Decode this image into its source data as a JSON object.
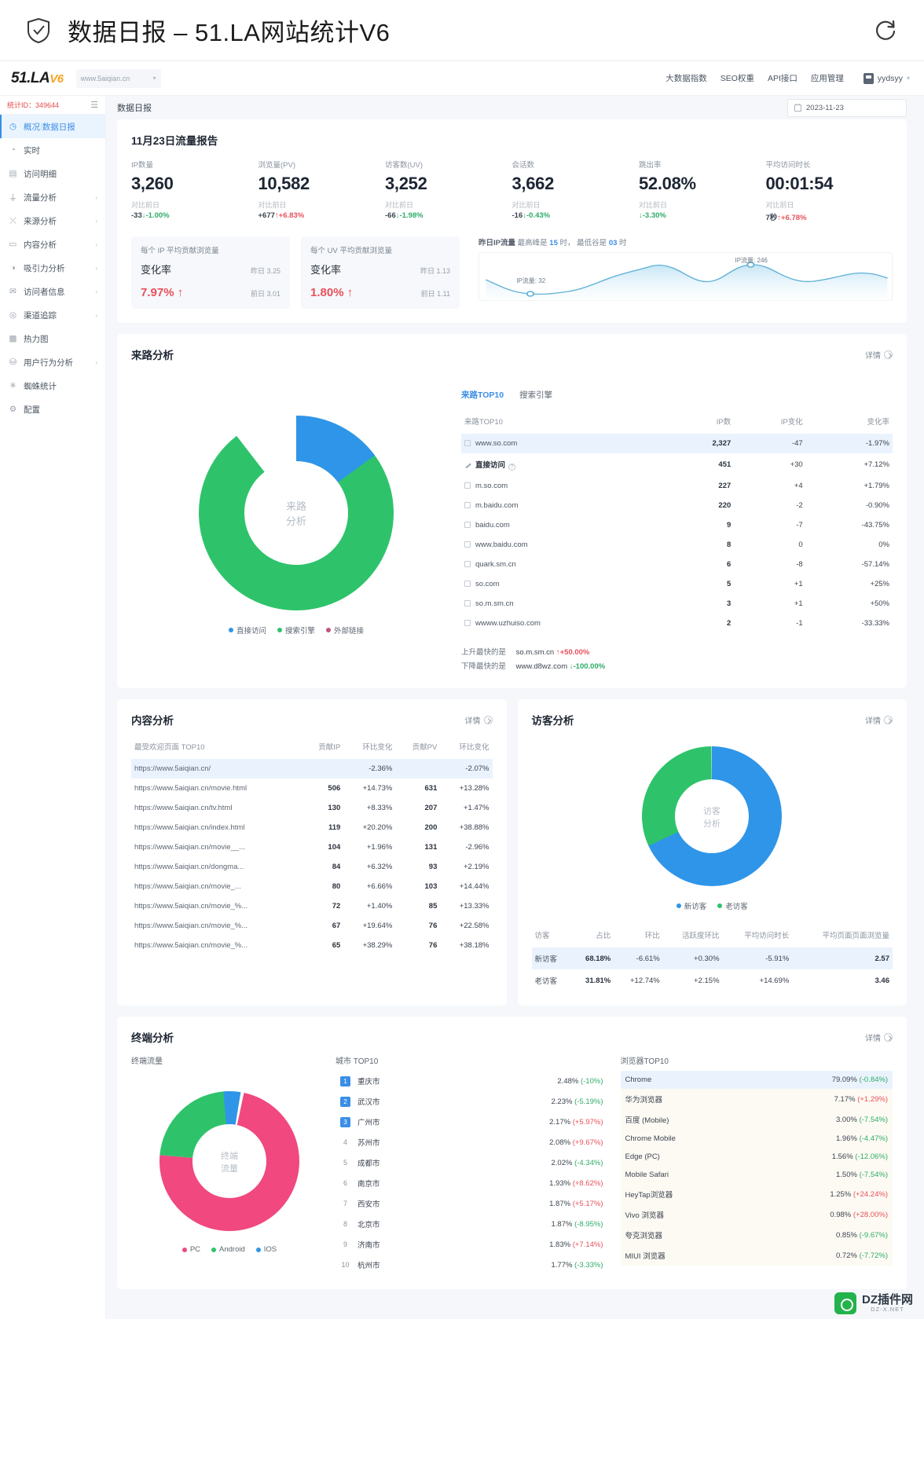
{
  "window": {
    "title": "数据日报 – 51.LA网站统计V6",
    "shield_icon": "shield-check-icon",
    "refresh_icon": "refresh-icon"
  },
  "appnav": {
    "logo": "51.LA",
    "logo_version": "V6",
    "site": "www.5aiqian.cn",
    "links": [
      "大数据指数",
      "SEO权重",
      "API接口",
      "应用管理"
    ],
    "user": "yydsyy"
  },
  "sidebar": {
    "stat_id_label": "统计ID：349644",
    "items": [
      {
        "label": "概况",
        "sub": "数据日报",
        "icon": "gauge-icon",
        "active": true,
        "chevron": false
      },
      {
        "label": "实时",
        "icon": "clock-icon",
        "active": false,
        "chevron": false
      },
      {
        "label": "访问明细",
        "icon": "list-icon",
        "active": false,
        "chevron": false
      },
      {
        "label": "流量分析",
        "icon": "chart-icon",
        "active": false,
        "chevron": true
      },
      {
        "label": "来源分析",
        "icon": "share-icon",
        "active": false,
        "chevron": true
      },
      {
        "label": "内容分析",
        "icon": "doc-icon",
        "active": false,
        "chevron": true
      },
      {
        "label": "吸引力分析",
        "icon": "magnet-icon",
        "active": false,
        "chevron": true
      },
      {
        "label": "访问者信息",
        "icon": "mail-icon",
        "active": false,
        "chevron": true
      },
      {
        "label": "渠道追踪",
        "icon": "target-icon",
        "active": false,
        "chevron": true
      },
      {
        "label": "热力图",
        "icon": "heatmap-icon",
        "active": false,
        "chevron": false
      },
      {
        "label": "用户行为分析",
        "icon": "behavior-icon",
        "active": false,
        "chevron": true
      },
      {
        "label": "蜘蛛统计",
        "icon": "spider-icon",
        "active": false,
        "chevron": false
      },
      {
        "label": "配置",
        "icon": "gear-icon",
        "active": false,
        "chevron": false
      }
    ]
  },
  "breadcrumb": "数据日报",
  "date_picker": {
    "value": "2023-11-23",
    "icon": "calendar-icon"
  },
  "report": {
    "title": "11月23日流量报告",
    "kpis": [
      {
        "label": "IP数量",
        "value": "3,260",
        "sub": "对比前日",
        "delta": "-33",
        "dir": "down",
        "pct": "-1.00%"
      },
      {
        "label": "浏览量(PV)",
        "value": "10,582",
        "sub": "对比前日",
        "delta": "+677",
        "dir": "up",
        "pct": "+6.83%"
      },
      {
        "label": "访客数(UV)",
        "value": "3,252",
        "sub": "对比前日",
        "delta": "-66",
        "dir": "down",
        "pct": "-1.98%"
      },
      {
        "label": "会话数",
        "value": "3,662",
        "sub": "对比前日",
        "delta": "-16",
        "dir": "down",
        "pct": "-0.43%"
      },
      {
        "label": "跳出率",
        "value": "52.08%",
        "sub": "对比前日",
        "delta": "",
        "dir": "down",
        "pct": "-3.30%"
      },
      {
        "label": "平均访问时长",
        "value": "00:01:54",
        "sub": "对比前日",
        "delta": "7秒",
        "dir": "up",
        "pct": "+6.78%"
      }
    ],
    "rate_cards": [
      {
        "title": "每个 IP 平均贡献浏览量",
        "name": "变化率",
        "value": "7.97%",
        "dir": "up",
        "yesterday_label": "昨日",
        "yesterday": "3.25",
        "before_label": "前日",
        "before": "3.01"
      },
      {
        "title": "每个 UV 平均贡献浏览量",
        "name": "变化率",
        "value": "1.80%",
        "dir": "up",
        "yesterday_label": "昨日",
        "yesterday": "1.13",
        "before_label": "前日",
        "before": "1.11"
      }
    ],
    "spark": {
      "caption_bold": "昨日IP流量",
      "caption_peak_label": "最高峰是",
      "caption_peak": "15",
      "caption_peak_unit": "时，",
      "caption_low_label": "最低谷是",
      "caption_low": "03",
      "caption_low_unit": "时",
      "peak_label": "IP流量: 246",
      "low_label": "IP流量: 32"
    }
  },
  "referrer": {
    "title": "来路分析",
    "detail": "详情",
    "donut_center_1": "来路",
    "donut_center_2": "分析",
    "legend": [
      {
        "label": "直接访问",
        "color": "#2f95e8"
      },
      {
        "label": "搜索引擎",
        "color": "#2ec36b"
      },
      {
        "label": "外部链接",
        "color": "#c2557e"
      }
    ],
    "tabs": [
      {
        "label": "来路TOP10",
        "active": true
      },
      {
        "label": "搜索引擎",
        "active": false
      }
    ],
    "columns": [
      "来路TOP10",
      "IP数",
      "IP变化",
      "变化率"
    ],
    "rows": [
      {
        "name": "www.so.com",
        "icon": "site-icon",
        "ip": "2,327",
        "chg": "-47",
        "rate": "-1.97%",
        "dir": "down",
        "hi": true
      },
      {
        "name": "直接访问",
        "icon": "link-icon",
        "ip": "451",
        "chg": "+30",
        "rate": "+7.12%",
        "dir": "up",
        "help": true,
        "bold": true
      },
      {
        "name": "m.so.com",
        "icon": "site-icon",
        "ip": "227",
        "chg": "+4",
        "rate": "+1.79%",
        "dir": "up"
      },
      {
        "name": "m.baidu.com",
        "icon": "site-icon",
        "ip": "220",
        "chg": "-2",
        "rate": "-0.90%",
        "dir": "down"
      },
      {
        "name": "baidu.com",
        "icon": "site-icon",
        "ip": "9",
        "chg": "-7",
        "rate": "-43.75%",
        "dir": "down"
      },
      {
        "name": "www.baidu.com",
        "icon": "site-icon",
        "ip": "8",
        "chg": "0",
        "rate": "0%",
        "dir": "up"
      },
      {
        "name": "quark.sm.cn",
        "icon": "site-icon",
        "ip": "6",
        "chg": "-8",
        "rate": "-57.14%",
        "dir": "down"
      },
      {
        "name": "so.com",
        "icon": "site-icon",
        "ip": "5",
        "chg": "+1",
        "rate": "+25%",
        "dir": "up"
      },
      {
        "name": "so.m.sm.cn",
        "icon": "site-icon",
        "ip": "3",
        "chg": "+1",
        "rate": "+50%",
        "dir": "up"
      },
      {
        "name": "wwww.uzhuiso.com",
        "icon": "site-icon",
        "ip": "2",
        "chg": "-1",
        "rate": "-33.33%",
        "dir": "down"
      }
    ],
    "note_up_label": "上升最快的是",
    "note_up_name": "so.m.sm.cn",
    "note_up_pct": "+50.00%",
    "note_down_label": "下降最快的是",
    "note_down_name": "www.d8wz.com",
    "note_down_pct": "-100.00%",
    "chart_data": {
      "type": "pie",
      "title": "来路分析",
      "categories": [
        "直接访问",
        "搜索引擎",
        "外部链接"
      ],
      "values": [
        15,
        84,
        1
      ],
      "colors": [
        "#2f95e8",
        "#2ec36b",
        "#c2557e"
      ]
    }
  },
  "content": {
    "title": "内容分析",
    "detail": "详情",
    "columns": [
      "最受欢迎页面 TOP10",
      "贡献IP",
      "环比变化",
      "贡献PV",
      "环比变化"
    ],
    "rows": [
      {
        "page": "https://www.5aiqian.cn/",
        "ip": "",
        "ipc": "-2.36%",
        "ipd": "down",
        "pv": "",
        "pvc": "-2.07%",
        "pvd": "down",
        "hi": true
      },
      {
        "page": "https://www.5aiqian.cn/movie.html",
        "ip": "506",
        "ipc": "+14.73%",
        "ipd": "up",
        "pv": "631",
        "pvc": "+13.28%",
        "pvd": "up"
      },
      {
        "page": "https://www.5aiqian.cn/tv.html",
        "ip": "130",
        "ipc": "+8.33%",
        "ipd": "up",
        "pv": "207",
        "pvc": "+1.47%",
        "pvd": "up"
      },
      {
        "page": "https://www.5aiqian.cn/index.html",
        "ip": "119",
        "ipc": "+20.20%",
        "ipd": "up",
        "pv": "200",
        "pvc": "+38.88%",
        "pvd": "up"
      },
      {
        "page": "https://www.5aiqian.cn/movie__...",
        "ip": "104",
        "ipc": "+1.96%",
        "ipd": "up",
        "pv": "131",
        "pvc": "-2.96%",
        "pvd": "down"
      },
      {
        "page": "https://www.5aiqian.cn/dongma...",
        "ip": "84",
        "ipc": "+6.32%",
        "ipd": "up",
        "pv": "93",
        "pvc": "+2.19%",
        "pvd": "up"
      },
      {
        "page": "https://www.5aiqian.cn/movie_...",
        "ip": "80",
        "ipc": "+6.66%",
        "ipd": "up",
        "pv": "103",
        "pvc": "+14.44%",
        "pvd": "up"
      },
      {
        "page": "https://www.5aiqian.cn/movie_%...",
        "ip": "72",
        "ipc": "+1.40%",
        "ipd": "up",
        "pv": "85",
        "pvc": "+13.33%",
        "pvd": "up"
      },
      {
        "page": "https://www.5aiqian.cn/movie_%...",
        "ip": "67",
        "ipc": "+19.64%",
        "ipd": "up",
        "pv": "76",
        "pvc": "+22.58%",
        "pvd": "up"
      },
      {
        "page": "https://www.5aiqian.cn/movie_%...",
        "ip": "65",
        "ipc": "+38.29%",
        "ipd": "up",
        "pv": "76",
        "pvc": "+38.18%",
        "pvd": "up"
      }
    ]
  },
  "visitor": {
    "title": "访客分析",
    "detail": "详情",
    "donut_center_1": "访客",
    "donut_center_2": "分析",
    "legend": [
      {
        "label": "新访客",
        "color": "#2f95e8"
      },
      {
        "label": "老访客",
        "color": "#2ec36b"
      }
    ],
    "columns": [
      "访客",
      "占比",
      "环比",
      "活跃度环比",
      "平均访问时长",
      "平均页面页面浏览量"
    ],
    "rows": [
      {
        "name": "新访客",
        "pct": "68.18%",
        "hb": "-6.61%",
        "hbd": "down",
        "act": "+0.30%",
        "actd": "up",
        "dur": "-5.91%",
        "durd": "down",
        "pv": "2.57",
        "hi": true
      },
      {
        "name": "老访客",
        "pct": "31.81%",
        "hb": "+12.74%",
        "hbd": "up",
        "act": "+2.15%",
        "actd": "up",
        "dur": "+14.69%",
        "durd": "up",
        "pv": "3.46"
      }
    ],
    "chart_data": {
      "type": "pie",
      "title": "访客分析",
      "categories": [
        "新访客",
        "老访客"
      ],
      "values": [
        68.18,
        31.81
      ],
      "colors": [
        "#2f95e8",
        "#2ec36b"
      ]
    }
  },
  "terminal": {
    "title": "终端分析",
    "detail": "详情",
    "donut_title": "终端流量",
    "donut_center_1": "终端",
    "donut_center_2": "流量",
    "legend": [
      {
        "label": "PC",
        "color": "#f0487f"
      },
      {
        "label": "Android",
        "color": "#2ec36b"
      },
      {
        "label": "IOS",
        "color": "#2f95e8"
      }
    ],
    "city_title": "城市 TOP10",
    "cities": [
      {
        "rank": 1,
        "name": "重庆市",
        "value": "2.48%",
        "chg": "(-10%)",
        "dir": "down",
        "badge": true
      },
      {
        "rank": 2,
        "name": "武汉市",
        "value": "2.23%",
        "chg": "(-5.19%)",
        "dir": "down",
        "badge": true
      },
      {
        "rank": 3,
        "name": "广州市",
        "value": "2.17%",
        "chg": "(+5.97%)",
        "dir": "up",
        "badge": true
      },
      {
        "rank": 4,
        "name": "苏州市",
        "value": "2.08%",
        "chg": "(+9.67%)",
        "dir": "up"
      },
      {
        "rank": 5,
        "name": "成都市",
        "value": "2.02%",
        "chg": "(-4.34%)",
        "dir": "down"
      },
      {
        "rank": 6,
        "name": "南京市",
        "value": "1.93%",
        "chg": "(+8.62%)",
        "dir": "up"
      },
      {
        "rank": 7,
        "name": "西安市",
        "value": "1.87%",
        "chg": "(+5.17%)",
        "dir": "up"
      },
      {
        "rank": 8,
        "name": "北京市",
        "value": "1.87%",
        "chg": "(-8.95%)",
        "dir": "down"
      },
      {
        "rank": 9,
        "name": "济南市",
        "value": "1.83%",
        "chg": "(+7.14%)",
        "dir": "up"
      },
      {
        "rank": 10,
        "name": "杭州市",
        "value": "1.77%",
        "chg": "(-3.33%)",
        "dir": "down"
      }
    ],
    "browser_title": "浏览器TOP10",
    "browsers": [
      {
        "name": "Chrome",
        "value": "79.09%",
        "chg": "(-0.84%)",
        "dir": "down",
        "hl": true
      },
      {
        "name": "华为浏览器",
        "value": "7.17%",
        "chg": "(+1.29%)",
        "dir": "up"
      },
      {
        "name": "百度 (Mobile)",
        "value": "3.00%",
        "chg": "(-7.54%)",
        "dir": "down"
      },
      {
        "name": "Chrome Mobile",
        "value": "1.96%",
        "chg": "(-4.47%)",
        "dir": "down"
      },
      {
        "name": "Edge (PC)",
        "value": "1.56%",
        "chg": "(-12.06%)",
        "dir": "down"
      },
      {
        "name": "Mobile Safari",
        "value": "1.50%",
        "chg": "(-7.54%)",
        "dir": "down"
      },
      {
        "name": "HeyTap浏览器",
        "value": "1.25%",
        "chg": "(+24.24%)",
        "dir": "up"
      },
      {
        "name": "Vivo 浏览器",
        "value": "0.98%",
        "chg": "(+28.00%)",
        "dir": "up"
      },
      {
        "name": "夸克浏览器",
        "value": "0.85%",
        "chg": "(-9.67%)",
        "dir": "down"
      },
      {
        "name": "MIUI 浏览器",
        "value": "0.72%",
        "chg": "(-7.72%)",
        "dir": "down"
      }
    ],
    "chart_data": {
      "type": "pie",
      "title": "终端流量",
      "categories": [
        "PC",
        "Android",
        "IOS"
      ],
      "values": [
        73,
        23,
        4
      ],
      "colors": [
        "#f0487f",
        "#2ec36b",
        "#2f95e8"
      ]
    }
  },
  "watermark": {
    "text": "DZ插件网",
    "sub": "DZ-X.NET"
  }
}
